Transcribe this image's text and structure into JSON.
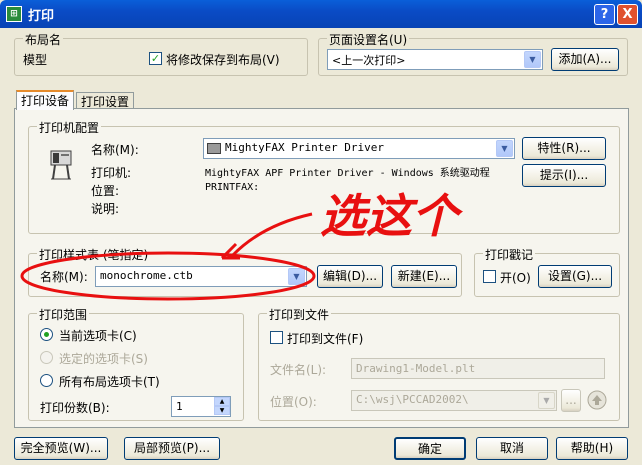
{
  "window": {
    "title": "打印",
    "help_btn": "?",
    "close_btn": "X"
  },
  "layout_group": {
    "legend": "布局名",
    "name": "模型",
    "save_changes_label": "将修改保存到布局(V)",
    "save_changes_checked": true
  },
  "page_setup_group": {
    "legend": "页面设置名(U)",
    "selected": "<上一次打印>",
    "add_button": "添加(A)..."
  },
  "tabs": [
    {
      "label": "打印设备",
      "active": true
    },
    {
      "label": "打印设置",
      "active": false
    }
  ],
  "printer_config": {
    "legend": "打印机配置",
    "name_label": "名称(M):",
    "name_value": "MightyFAX Printer Driver",
    "printer_label": "打印机:",
    "printer_value": "MightyFAX APF Printer Driver - Windows 系统驱动程",
    "location_label": "位置:",
    "location_value": "PRINTFAX:",
    "description_label": "说明:",
    "properties_button": "特性(R)...",
    "hints_button": "提示(I)..."
  },
  "annotation": {
    "text": "选这个"
  },
  "plot_style": {
    "legend": "打印样式表 (笔指定)",
    "name_label": "名称(M):",
    "value": "monochrome.ctb",
    "edit_button": "编辑(D)...",
    "new_button": "新建(E)..."
  },
  "plot_stamp": {
    "legend": "打印戳记",
    "on_label": "开(O)",
    "on_checked": false,
    "settings_button": "设置(G)..."
  },
  "plot_range": {
    "legend": "打印范围",
    "options": [
      {
        "label": "当前选项卡(C)",
        "selected": true,
        "disabled": false
      },
      {
        "label": "选定的选项卡(S)",
        "selected": false,
        "disabled": true
      },
      {
        "label": "所有布局选项卡(T)",
        "selected": false,
        "disabled": false
      }
    ],
    "copies_label": "打印份数(B):",
    "copies_value": "1"
  },
  "plot_to_file": {
    "legend": "打印到文件",
    "checkbox_label": "打印到文件(F)",
    "checked": false,
    "filename_label": "文件名(L):",
    "filename_value": "Drawing1-Model.plt",
    "location_label": "位置(O):",
    "location_value": "C:\\wsj\\PCCAD2002\\",
    "browse_button": "..."
  },
  "footer": {
    "full_preview": "完全预览(W)...",
    "partial_preview": "局部预览(P)...",
    "ok": "确定",
    "cancel": "取消",
    "help": "帮助(H)"
  },
  "colors": {
    "titlebar": "#0a4bc5",
    "annotation": "#e81010",
    "dialog_bg": "#ece9d8"
  }
}
